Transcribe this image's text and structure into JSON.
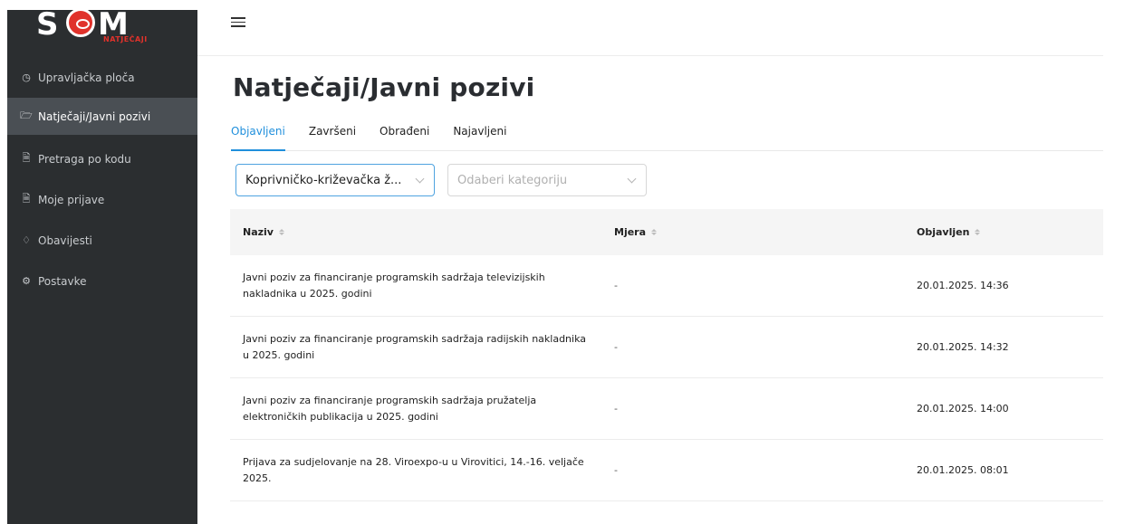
{
  "logo": {
    "letters_left": "S",
    "letters_right": "M",
    "subtitle": "NATJEČAJI"
  },
  "sidebar": {
    "items": [
      {
        "label": "Upravljačka ploča",
        "icon": "dashboard-icon"
      },
      {
        "label": "Natječaji/Javni pozivi",
        "icon": "folder-icon",
        "active": true
      },
      {
        "label": "Pretraga po kodu",
        "icon": "file-icon"
      },
      {
        "label": "Moje prijave",
        "icon": "file-text-icon"
      },
      {
        "label": "Obavijesti",
        "icon": "bell-icon"
      },
      {
        "label": "Postavke",
        "icon": "gear-icon"
      }
    ]
  },
  "page": {
    "title": "Natječaji/Javni pozivi"
  },
  "tabs": [
    {
      "label": "Objavljeni",
      "active": true
    },
    {
      "label": "Završeni"
    },
    {
      "label": "Obrađeni"
    },
    {
      "label": "Najavljeni"
    }
  ],
  "filters": {
    "county": {
      "value": "Koprivničko-križevačka ž..."
    },
    "category": {
      "placeholder": "Odaberi kategoriju"
    }
  },
  "table": {
    "columns": [
      "Naziv",
      "Mjera",
      "Objavljen"
    ],
    "rows": [
      {
        "naziv": "Javni poziv za financiranje programskih sadržaja televizijskih nakladnika u 2025. godini",
        "mjera": "-",
        "objavljen": "20.01.2025. 14:36"
      },
      {
        "naziv": "Javni poziv za financiranje programskih sadržaja radijskih nakladnika u 2025. godini",
        "mjera": "-",
        "objavljen": "20.01.2025. 14:32"
      },
      {
        "naziv": "Javni poziv za financiranje programskih sadržaja pružatelja elektroničkih publikacija u 2025. godini",
        "mjera": "-",
        "objavljen": "20.01.2025. 14:00"
      },
      {
        "naziv": "Prijava za sudjelovanje na 28. Viroexpo-u u Virovitici, 14.-16. veljače 2025.",
        "mjera": "-",
        "objavljen": "20.01.2025. 08:01"
      }
    ]
  },
  "colors": {
    "sidebar_bg": "#2b2e30",
    "active_item_bg": "#4a4f54",
    "accent": "#1f8fdc",
    "logo_red": "#e0322b"
  }
}
